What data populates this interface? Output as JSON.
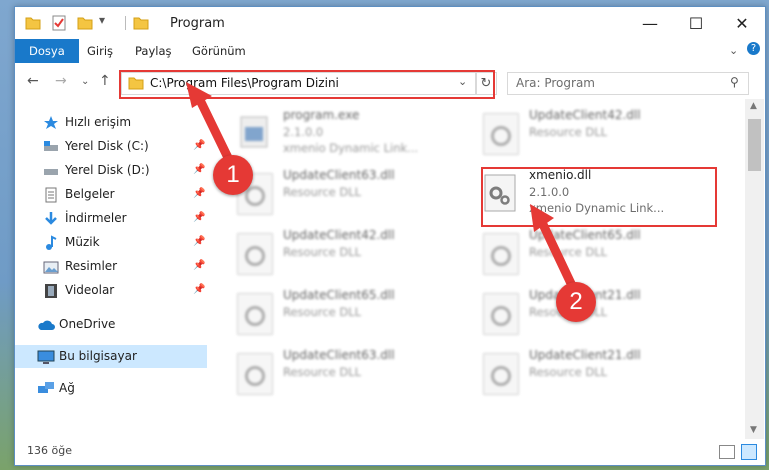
{
  "window": {
    "title": "Program"
  },
  "ribbon": {
    "tabs": [
      "Dosya",
      "Giriş",
      "Paylaş",
      "Görünüm"
    ]
  },
  "address": {
    "path": "C:\\Program Files\\Program Dizini"
  },
  "search": {
    "placeholder": "Ara: Program"
  },
  "nav": {
    "items": [
      {
        "label": "Hızlı erişim"
      },
      {
        "label": "Yerel Disk (C:)"
      },
      {
        "label": "Yerel Disk (D:)"
      },
      {
        "label": "Belgeler"
      },
      {
        "label": "İndirmeler"
      },
      {
        "label": "Müzik"
      },
      {
        "label": "Resimler"
      },
      {
        "label": "Videolar"
      },
      {
        "label": "OneDrive"
      },
      {
        "label": "Bu bilgisayar"
      },
      {
        "label": "Ağ"
      }
    ]
  },
  "files": [
    {
      "name": "program.exe",
      "line2": "2.1.0.0",
      "line3": "xmenio Dynamic Link..."
    },
    {
      "name": "UpdateClient42.dll",
      "line2": "Resource DLL",
      "line3": ""
    },
    {
      "name": "UpdateClient63.dll",
      "line2": "Resource DLL",
      "line3": ""
    },
    {
      "name": "xmenio.dll",
      "line2": "2.1.0.0",
      "line3": "xmenio Dynamic Link..."
    },
    {
      "name": "UpdateClient42.dll",
      "line2": "Resource DLL",
      "line3": ""
    },
    {
      "name": "UpdateClient65.dll",
      "line2": "Resource DLL",
      "line3": ""
    },
    {
      "name": "UpdateClient65.dll",
      "line2": "Resource DLL",
      "line3": ""
    },
    {
      "name": "UpdateClient21.dll",
      "line2": "Resource DLL",
      "line3": ""
    },
    {
      "name": "UpdateClient63.dll",
      "line2": "Resource DLL",
      "line3": ""
    },
    {
      "name": "UpdateClient21.dll",
      "line2": "Resource DLL",
      "line3": ""
    }
  ],
  "status": {
    "count": "136 öğe"
  },
  "annotations": {
    "step1": "1",
    "step2": "2"
  },
  "colors": {
    "accent": "#1979ca",
    "highlight": "#e53935",
    "selected": "#cce8ff"
  }
}
